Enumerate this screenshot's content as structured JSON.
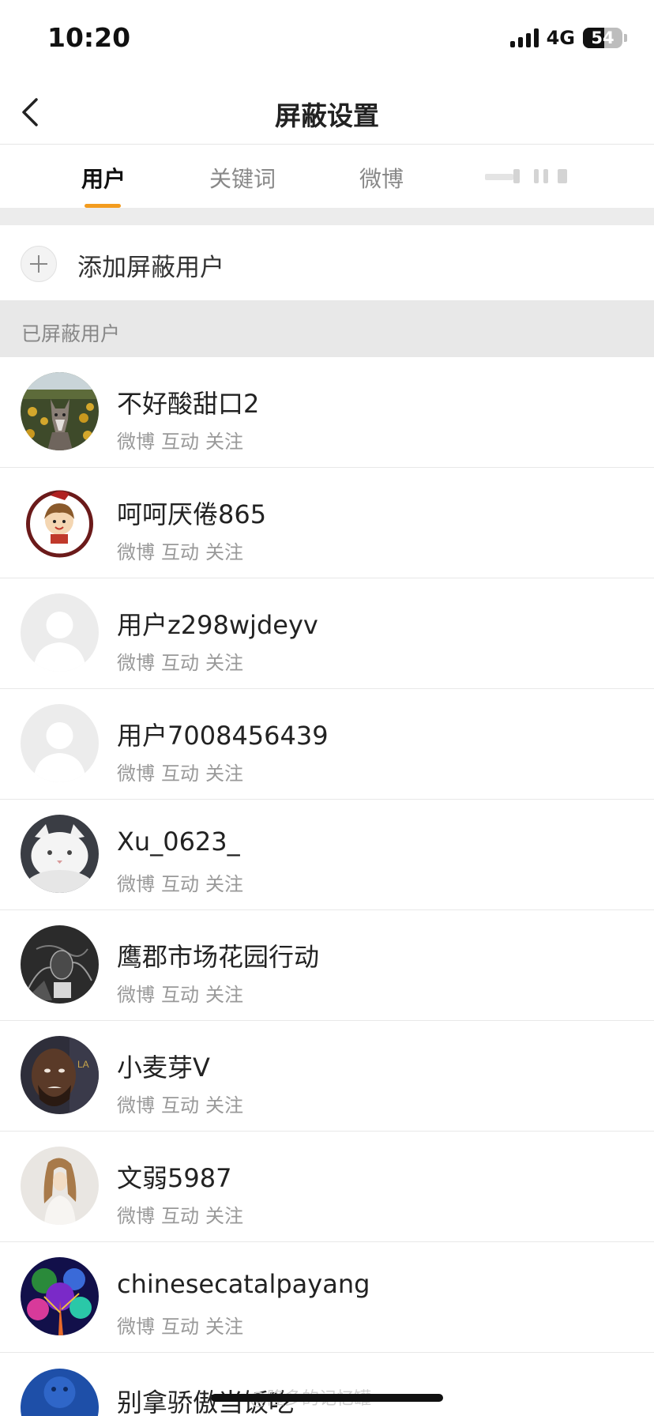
{
  "status_bar": {
    "time": "10:20",
    "network": "4G",
    "battery": "54",
    "battery_level": 54
  },
  "nav": {
    "title": "屏蔽设置"
  },
  "tabs": [
    {
      "label": "用户",
      "active": true
    },
    {
      "label": "关键词",
      "active": false
    },
    {
      "label": "微博",
      "active": false
    }
  ],
  "add_user": {
    "label": "添加屏蔽用户"
  },
  "section": {
    "title": "已屏蔽用户"
  },
  "meta_labels": [
    "微博",
    "互动",
    "关注"
  ],
  "users": [
    {
      "name": "不好酸甜口2",
      "avatar": "wolf-photo-avatar"
    },
    {
      "name": "呵呵厌倦865",
      "avatar": "cartoon-boy-avatar"
    },
    {
      "name": "用户z298wjdeyv",
      "avatar": "default-avatar"
    },
    {
      "name": "用户7008456439",
      "avatar": "default-avatar"
    },
    {
      "name": "Xu_0623_",
      "avatar": "white-cat-avatar"
    },
    {
      "name": "鹰郡市场花园行动",
      "avatar": "dark-sketch-avatar"
    },
    {
      "name": "小麦芽V",
      "avatar": "basketball-player-avatar"
    },
    {
      "name": "文弱5987",
      "avatar": "girl-photo-avatar"
    },
    {
      "name": "chinesecatalpayang",
      "avatar": "colorful-tree-avatar"
    }
  ],
  "partial_user": {
    "name": "别拿骄傲当饭吃",
    "avatar": "blue-avatar"
  },
  "watermark": "@隆多的记忆罐"
}
